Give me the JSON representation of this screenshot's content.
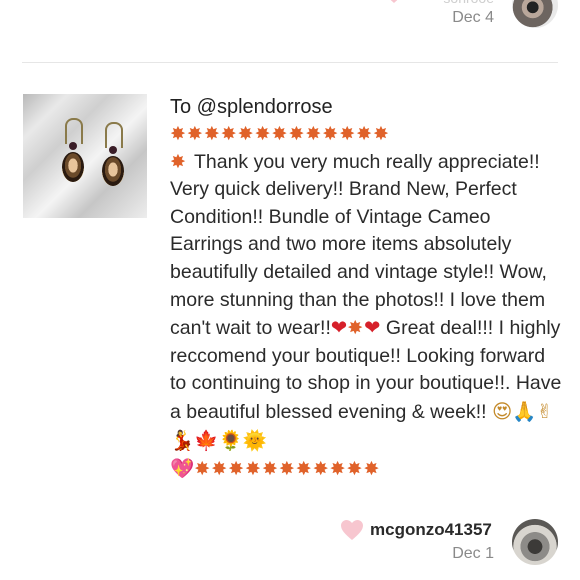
{
  "previous_comment": {
    "faded_text": "sonrooe",
    "date": "Dec 4"
  },
  "comment": {
    "to_line": "To @splendorrose",
    "line1_sparkles": "✸✸✸✸✸✸✸✸✸✸✸✸✸",
    "line2_prefix": "✸ ",
    "body_part1": "Thank you very much really appreciate!! Very quick delivery!! Brand New, Perfect Condition!! Bundle of Vintage Cameo Earrings and two more items absolutely beautifully detailed and vintage style!! Wow, more stunning than the photos!! I love them can't wait to wear!!",
    "emoji_a": "❤",
    "emoji_b": "✸",
    "emoji_c": "❤",
    "body_part2": " Great deal!!! I highly reccomend your boutique!! Looking forward to continuing to shop in your boutique!!. Have a beautiful blessed evening & week!! ",
    "emoji_row": "😍🙏✌💃🍁🌻🌞",
    "closing_emoji": "💖",
    "closing_sparkles": "✸✸✸✸✸✸✸✸✸✸✸"
  },
  "author": {
    "username": "mcgonzo41357",
    "date": "Dec 1"
  },
  "icons": {
    "like": "heart-icon",
    "thumb": "earrings-photo"
  },
  "colors": {
    "heart": "#f7c6cf",
    "date": "#8a8a8a",
    "sparkle": "#e0622a"
  }
}
